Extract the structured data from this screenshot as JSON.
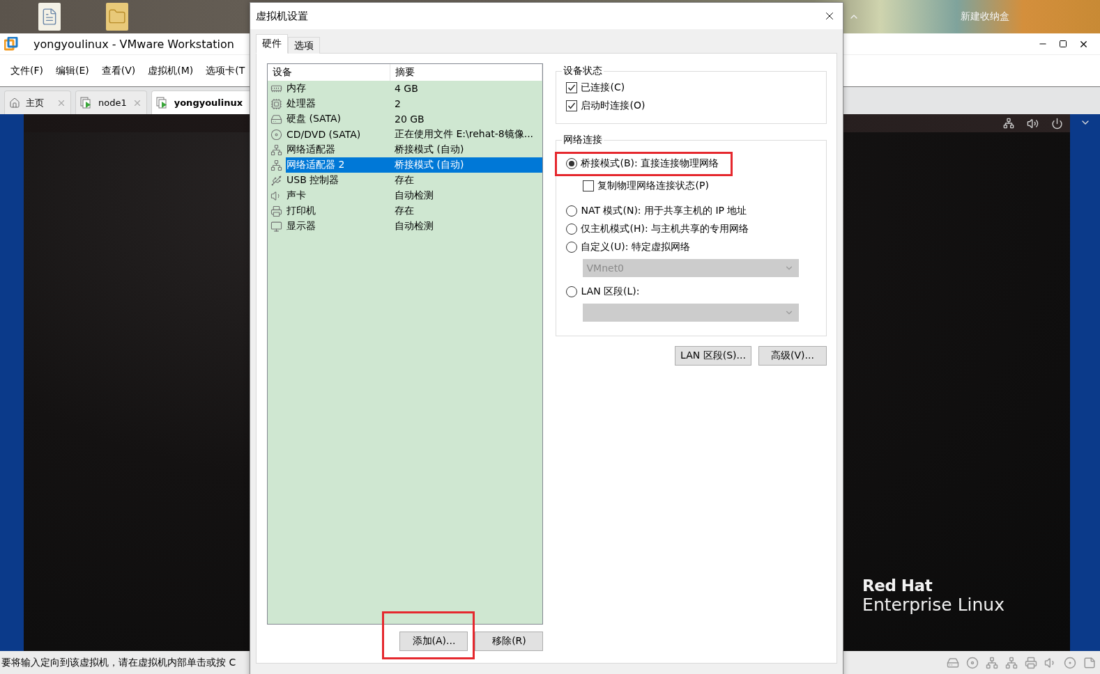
{
  "desktop": {
    "shelf_label": "新建收纳盒"
  },
  "app_window": {
    "title": "yongyoulinux - VMware Workstation",
    "menu": [
      "文件(F)",
      "编辑(E)",
      "查看(V)",
      "虚拟机(M)",
      "选项卡(T"
    ],
    "tabs": [
      {
        "label": "主页",
        "kind": "home",
        "selected": false
      },
      {
        "label": "node1",
        "kind": "vm",
        "selected": false
      },
      {
        "label": "yongyoulinux",
        "kind": "vm",
        "selected": true
      }
    ],
    "guest_logo": {
      "line_1": "Red Hat",
      "line_2": "Enterprise Linux"
    },
    "status_bar": "要将输入定向到该虚拟机，请在虚拟机内部单击或按 C"
  },
  "dialog": {
    "title": "虚拟机设置",
    "tabs": [
      {
        "label": "硬件",
        "selected": true
      },
      {
        "label": "选项",
        "selected": false
      }
    ],
    "device_table": {
      "columns": [
        "设备",
        "摘要"
      ],
      "rows": [
        {
          "kind": "memory",
          "device": "内存",
          "summary": "4 GB",
          "selected": false
        },
        {
          "kind": "cpu",
          "device": "处理器",
          "summary": "2",
          "selected": false
        },
        {
          "kind": "disk",
          "device": "硬盘 (SATA)",
          "summary": "20 GB",
          "selected": false
        },
        {
          "kind": "cd",
          "device": "CD/DVD (SATA)",
          "summary": "正在使用文件 E:\\rehat-8镜像...",
          "selected": false
        },
        {
          "kind": "network",
          "device": "网络适配器",
          "summary": "桥接模式 (自动)",
          "selected": false
        },
        {
          "kind": "network",
          "device": "网络适配器 2",
          "summary": "桥接模式 (自动)",
          "selected": true
        },
        {
          "kind": "usb",
          "device": "USB 控制器",
          "summary": "存在",
          "selected": false
        },
        {
          "kind": "sound",
          "device": "声卡",
          "summary": "自动检测",
          "selected": false
        },
        {
          "kind": "printer",
          "device": "打印机",
          "summary": "存在",
          "selected": false
        },
        {
          "kind": "display",
          "device": "显示器",
          "summary": "自动检测",
          "selected": false
        }
      ]
    },
    "list_buttons": [
      {
        "label": "添加(A)...",
        "highlighted": true
      },
      {
        "label": "移除(R)"
      }
    ],
    "device_status": {
      "title": "设备状态",
      "options": [
        {
          "label": "已连接(C)",
          "checked": true
        },
        {
          "label": "启动时连接(O)",
          "checked": true
        }
      ]
    },
    "network": {
      "title": "网络连接",
      "modes": [
        {
          "label": "桥接模式(B): 直接连接物理网络",
          "selected": true,
          "highlighted": true,
          "option": {
            "label": "复制物理网络连接状态(P)",
            "checked": false
          }
        },
        {
          "label": "NAT 模式(N): 用于共享主机的 IP 地址",
          "selected": false
        },
        {
          "label": "仅主机模式(H): 与主机共享的专用网络",
          "selected": false
        },
        {
          "label": "自定义(U): 特定虚拟网络",
          "selected": false,
          "dropdown": {
            "value": "VMnet0",
            "disabled": true
          }
        },
        {
          "label": "LAN 区段(L):",
          "selected": false,
          "dropdown": {
            "disabled": true
          }
        }
      ]
    },
    "action_buttons": [
      "LAN 区段(S)...",
      "高级(V)..."
    ]
  }
}
